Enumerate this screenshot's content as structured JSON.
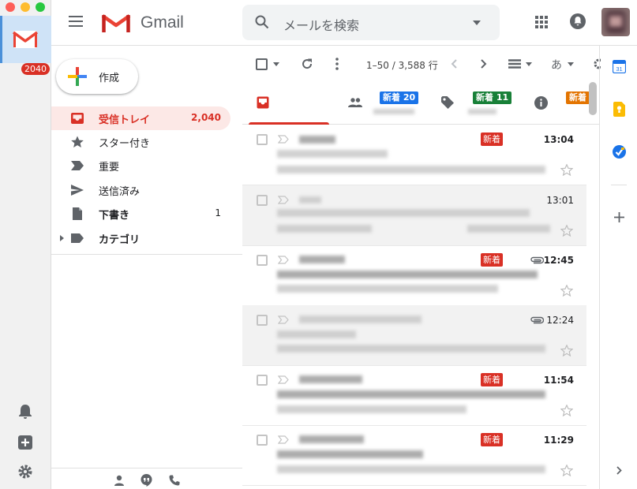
{
  "dock": {
    "badge": "2040",
    "traffic_colors": [
      "#fe5f57",
      "#febc2e",
      "#28c840"
    ]
  },
  "header": {
    "app_name": "Gmail",
    "search_placeholder": "メールを検索"
  },
  "sidebar": {
    "compose_label": "作成",
    "items": [
      {
        "label": "受信トレイ",
        "count": "2,040",
        "icon": "inbox-icon",
        "active": true,
        "bold": true
      },
      {
        "label": "スター付き",
        "count": "",
        "icon": "star-icon",
        "active": false,
        "bold": false
      },
      {
        "label": "重要",
        "count": "",
        "icon": "important-icon",
        "active": false,
        "bold": false
      },
      {
        "label": "送信済み",
        "count": "",
        "icon": "send-icon",
        "active": false,
        "bold": false
      },
      {
        "label": "下書き",
        "count": "1",
        "icon": "draft-icon",
        "active": false,
        "bold": true
      },
      {
        "label": "カテゴリ",
        "count": "",
        "icon": "label-icon",
        "active": false,
        "bold": true
      }
    ]
  },
  "toolbar": {
    "pager": "1–50 / 3,588 行",
    "input_tool_label": "あ"
  },
  "tabs": [
    {
      "icon": "inbox-tab-icon",
      "badge": "",
      "active": true
    },
    {
      "icon": "people-icon",
      "badge": "新着 20",
      "badge_color": "#1a73e8"
    },
    {
      "icon": "tag-icon",
      "badge": "新着 11",
      "badge_color": "#188038"
    },
    {
      "icon": "info-icon",
      "badge": "新着",
      "badge_color": "#e37400"
    }
  ],
  "mails": [
    {
      "time": "13:04",
      "new_badge": "新着",
      "unread": true,
      "attachment": false
    },
    {
      "time": "13:01",
      "new_badge": "",
      "unread": false,
      "attachment": false
    },
    {
      "time": "12:45",
      "new_badge": "新着",
      "unread": true,
      "attachment": true
    },
    {
      "time": "12:24",
      "new_badge": "",
      "unread": false,
      "attachment": true
    },
    {
      "time": "11:54",
      "new_badge": "新着",
      "unread": true,
      "attachment": false
    },
    {
      "time": "11:29",
      "new_badge": "新着",
      "unread": true,
      "attachment": false
    }
  ],
  "colors": {
    "accent_red": "#d93025",
    "active_nav_bg": "#fce8e6"
  }
}
